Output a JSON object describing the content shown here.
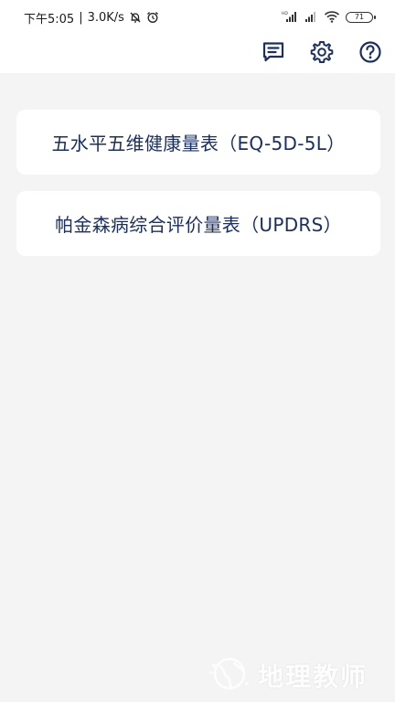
{
  "status_bar": {
    "time": "下午5:05",
    "net_speed": "3.0K/s",
    "battery_level": "71"
  },
  "toolbar": {
    "icons": [
      "message-icon",
      "gear-icon",
      "help-icon"
    ],
    "accent_color": "#1a2f66"
  },
  "scales": [
    {
      "label": "五水平五维健康量表（EQ-5D-5L）"
    },
    {
      "label": "帕金森病综合评价量表（UPDRS）"
    }
  ],
  "watermark": {
    "text": "地理教师"
  }
}
